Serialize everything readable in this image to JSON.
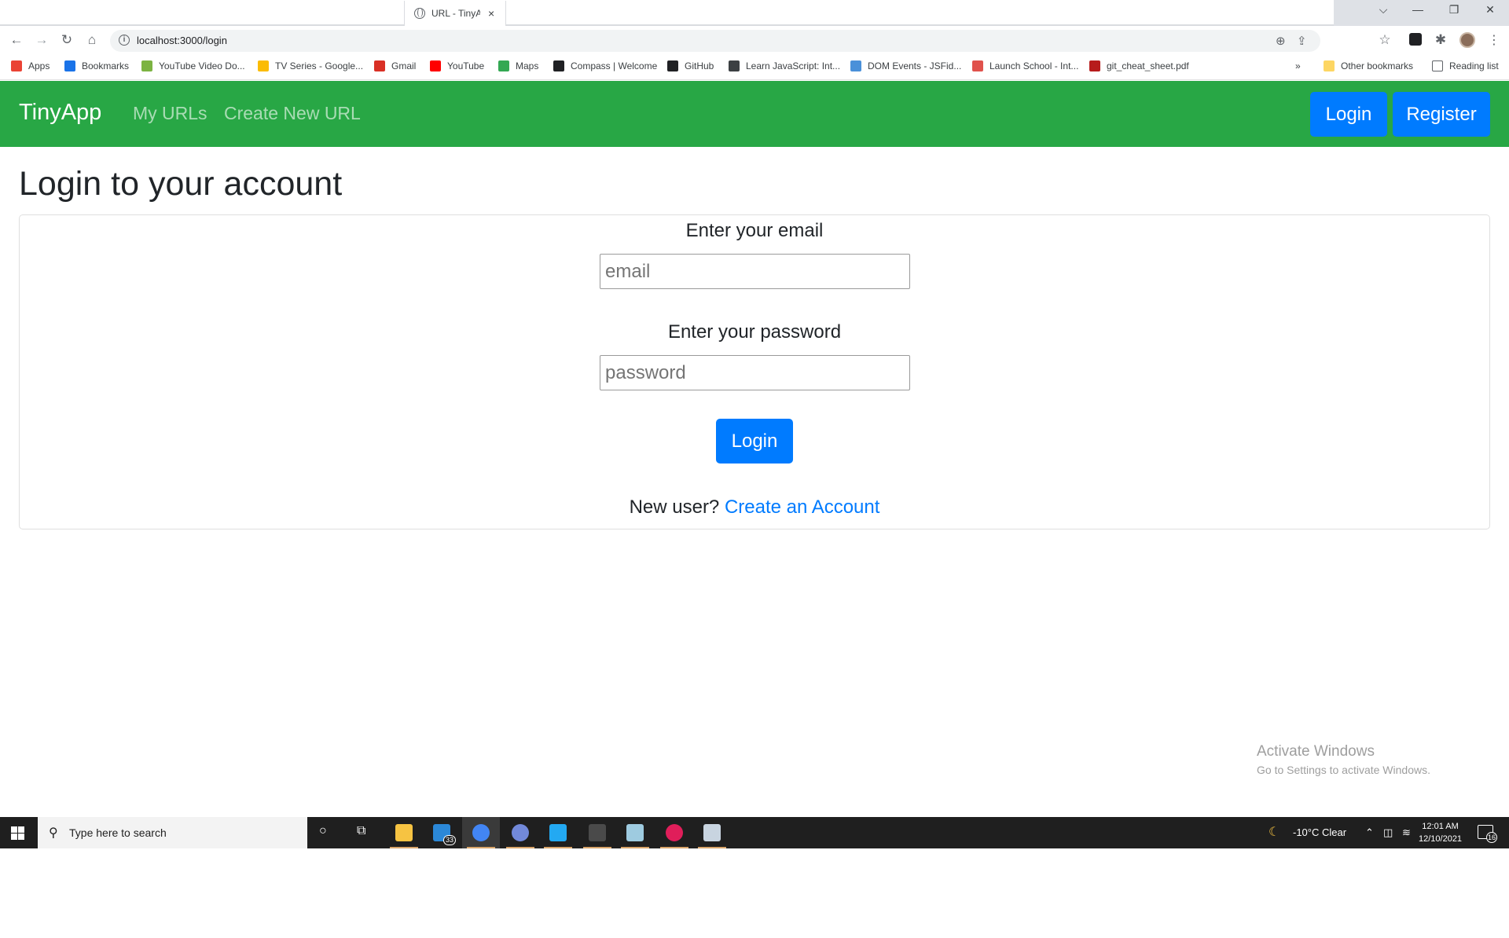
{
  "browser": {
    "tab_title": "URL - TinyApp",
    "tab_close": "×",
    "url": "localhost:3000/login",
    "controls": {
      "dropdown": "⌵",
      "minimize": "—",
      "restore": "❐",
      "close": "✕"
    },
    "toolbar_icons": {
      "back": "←",
      "forward": "→",
      "reload": "↻",
      "home": "⌂",
      "zoom": "⊕",
      "share": "⇪",
      "star": "☆",
      "puzzle": "✱",
      "menu": "⋮"
    }
  },
  "bookmarks": {
    "items": [
      {
        "label": "Apps",
        "color": "#ea4335"
      },
      {
        "label": "Bookmarks",
        "color": "#1a73e8"
      },
      {
        "label": "YouTube Video Do...",
        "color": "#7cb342"
      },
      {
        "label": "TV Series - Google...",
        "color": "#fbbc04"
      },
      {
        "label": "Gmail",
        "color": "#d93025"
      },
      {
        "label": "YouTube",
        "color": "#ff0000"
      },
      {
        "label": "Maps",
        "color": "#34a853"
      },
      {
        "label": "Compass | Welcome",
        "color": "#202124"
      },
      {
        "label": "GitHub",
        "color": "#202124"
      },
      {
        "label": "Learn JavaScript: Int...",
        "color": "#3c4043"
      },
      {
        "label": "DOM Events - JSFid...",
        "color": "#4a90d9"
      },
      {
        "label": "Launch School - Int...",
        "color": "#e0524c"
      },
      {
        "label": "git_cheat_sheet.pdf",
        "color": "#b71c1c"
      }
    ],
    "overflow": "»",
    "other": "Other bookmarks",
    "reading": "Reading list"
  },
  "navbar": {
    "brand": "TinyApp",
    "links": [
      "My URLs",
      "Create New URL"
    ],
    "login": "Login",
    "register": "Register",
    "bg_color": "#28a745",
    "button_color": "#007bff"
  },
  "main": {
    "title": "Login to your account",
    "email_label": "Enter your email",
    "email_placeholder": "email",
    "password_label": "Enter your password",
    "password_placeholder": "password",
    "submit": "Login",
    "new_user_text": "New user?",
    "create_account": "Create an Account"
  },
  "watermark": {
    "line1": "Activate Windows",
    "line2": "Go to Settings to activate Windows."
  },
  "taskbar": {
    "search_placeholder": "Type here to search",
    "mail_badge": "33",
    "weather": "-10°C  Clear",
    "time": "12:01 AM",
    "date": "12/10/2021",
    "notifications": "16",
    "apps": [
      {
        "name": "file-explorer",
        "color": "#f6c342"
      },
      {
        "name": "mail",
        "color": "#2b88d8"
      },
      {
        "name": "chrome",
        "color": "#4285f4"
      },
      {
        "name": "discord",
        "color": "#7289da"
      },
      {
        "name": "vscode",
        "color": "#23a9f2"
      },
      {
        "name": "terminal",
        "color": "#4a4a4a"
      },
      {
        "name": "notes",
        "color": "#9ecbe0"
      },
      {
        "name": "slack",
        "color": "#e01e5a"
      },
      {
        "name": "paint",
        "color": "#c8d4e0"
      }
    ]
  }
}
